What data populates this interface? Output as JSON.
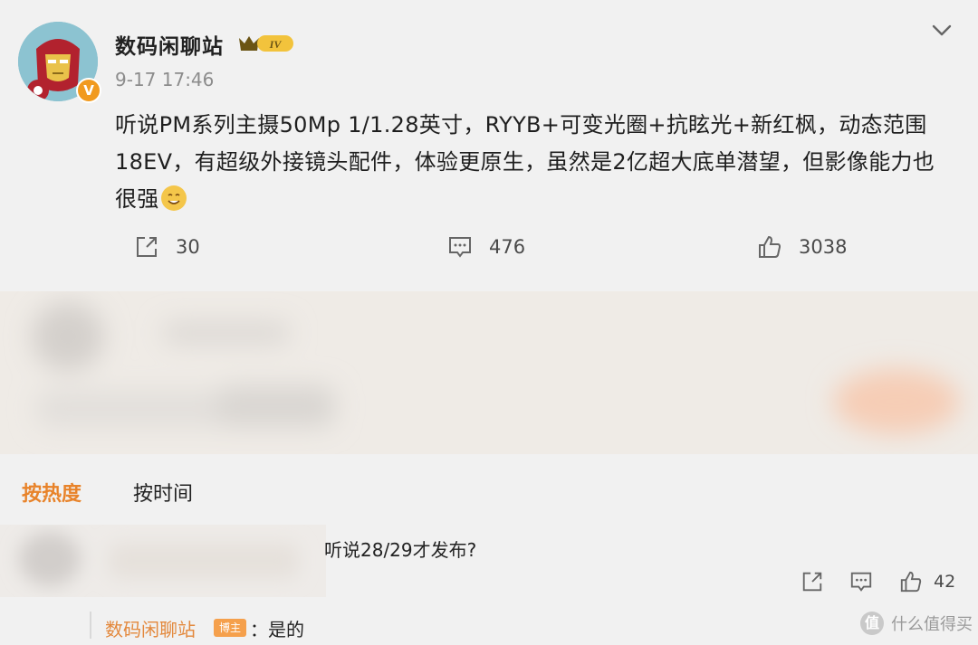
{
  "post": {
    "author": "数码闲聊站",
    "level_badge": "IV",
    "verified_mark": "V",
    "time": "9-17 17:46",
    "content": "听说PM系列主摄50Mp 1/1.28英寸，RYYB+可变光圈+抗眩光+新红枫，动态范围18EV，有超级外接镜头配件，体验更原生，虽然是2亿超大底单潜望，但影像能力也很强",
    "emoji": "smile-emoji",
    "actions": {
      "share": "30",
      "comment": "476",
      "like": "3038"
    }
  },
  "sort": {
    "hot": "按热度",
    "time": "按时间"
  },
  "comment": {
    "text": "听说28/29才发布?",
    "like": "42",
    "reply": {
      "author": "数码闲聊站",
      "tag": "博主",
      "text": "：是的"
    }
  },
  "watermark": {
    "logo": "值",
    "text": "什么值得买"
  },
  "colors": {
    "accent": "#e8832a",
    "badge": "#f19a1f",
    "background": "#f1f1f1"
  },
  "icons": [
    "share-icon",
    "comment-icon",
    "like-icon",
    "chevron-down-icon"
  ]
}
